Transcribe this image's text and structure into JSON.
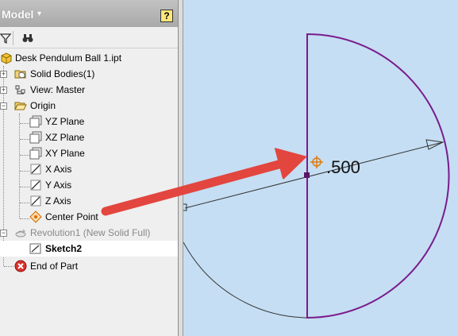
{
  "browser": {
    "title": "Model",
    "title_caret": "▾",
    "help": "?",
    "toolbar": {
      "filter_icon": "filter-icon",
      "find_icon": "binoculars-icon"
    },
    "tree": {
      "part": "Desk Pendulum Ball 1.ipt",
      "solid_bodies": "Solid Bodies(1)",
      "view": "View: Master",
      "origin": "Origin",
      "yz_plane": "YZ Plane",
      "xz_plane": "XZ Plane",
      "xy_plane": "XY Plane",
      "x_axis": "X Axis",
      "y_axis": "Y Axis",
      "z_axis": "Z Axis",
      "center_point": "Center Point",
      "revolution": "Revolution1 (New Solid Full)",
      "sketch": "Sketch2",
      "end_of_part": "End of Part"
    }
  },
  "canvas": {
    "dimension": ".500",
    "colors": {
      "background": "#c5def3",
      "profile": "#7b1c8c",
      "arrow": "#e2463f",
      "center_mark": "#e07b10"
    }
  }
}
